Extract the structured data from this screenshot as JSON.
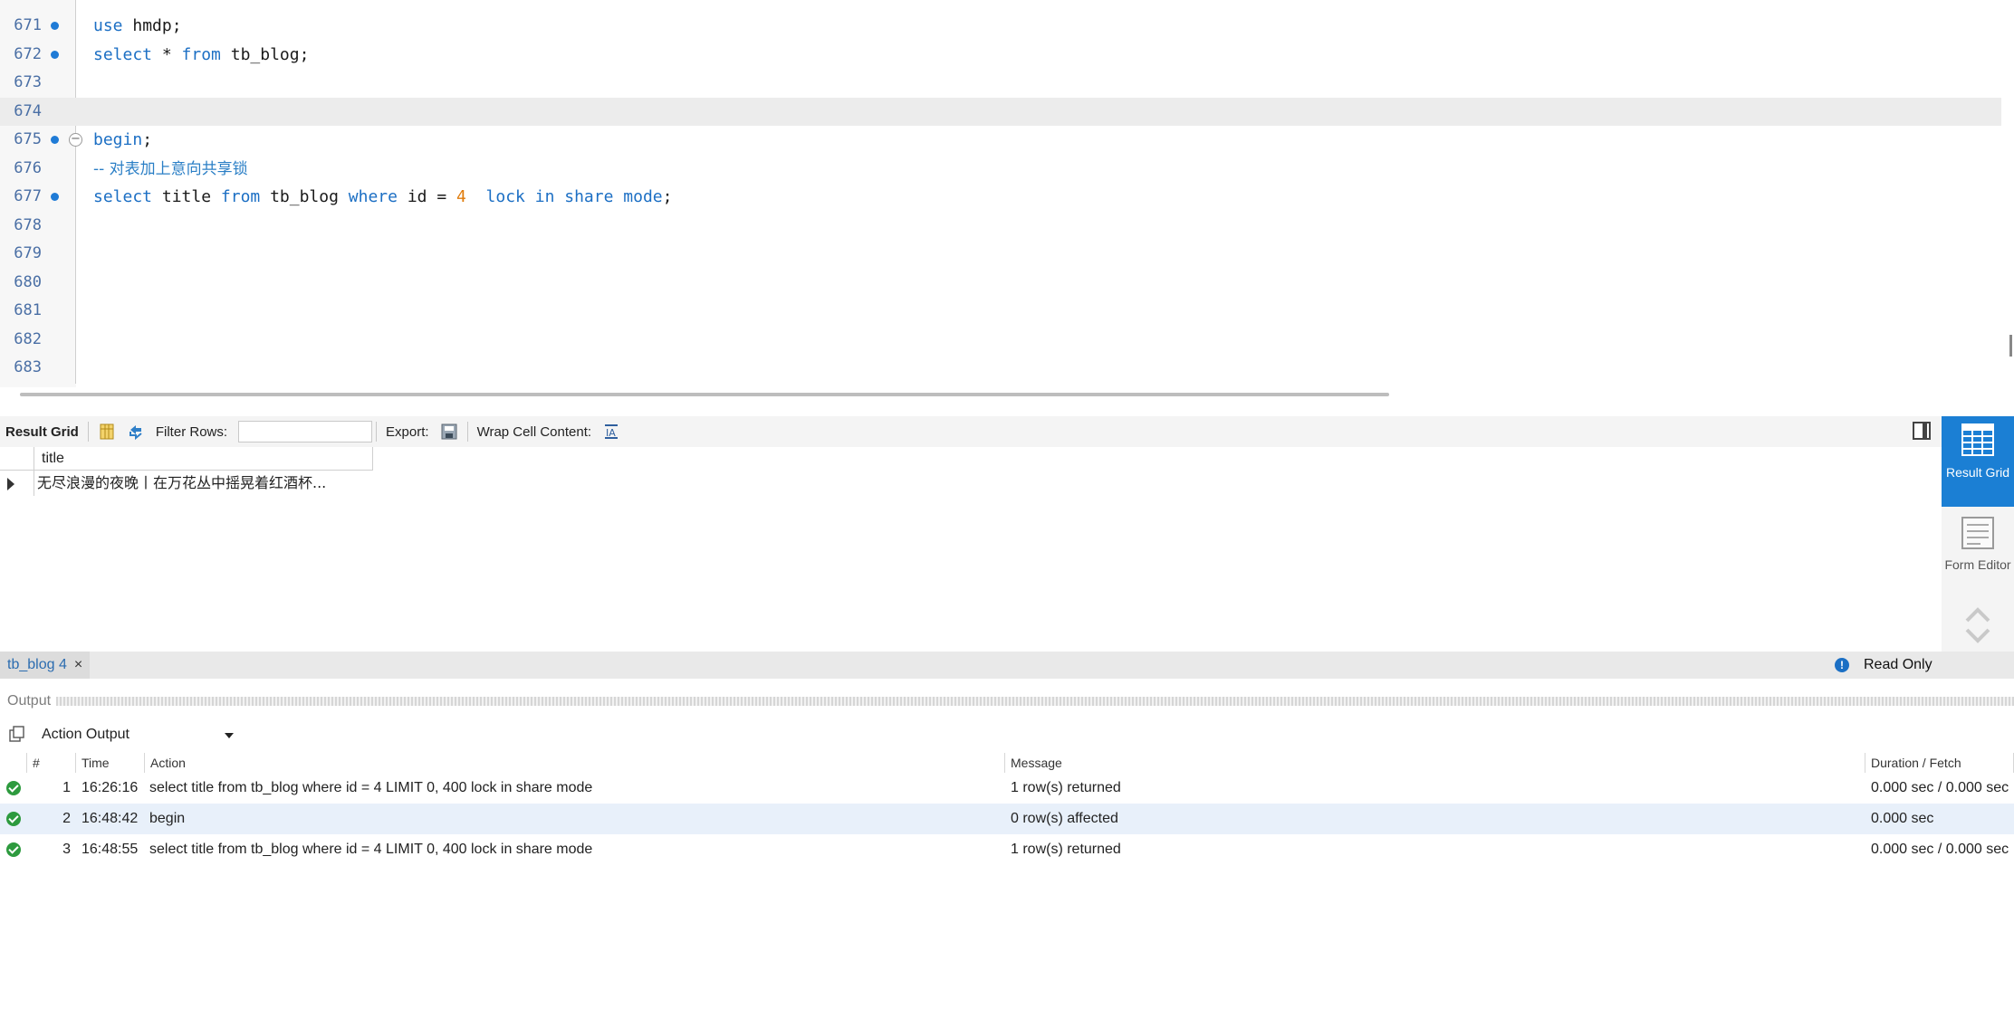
{
  "editor": {
    "lines": [
      {
        "num": "671",
        "tokens": [
          {
            "t": "use",
            "c": "kw"
          },
          {
            "t": " hmdp;",
            "c": ""
          }
        ],
        "marker": true,
        "fold": false,
        "current": false
      },
      {
        "num": "672",
        "tokens": [
          {
            "t": "select",
            "c": "kw"
          },
          {
            "t": " * ",
            "c": ""
          },
          {
            "t": "from",
            "c": "kw"
          },
          {
            "t": " tb_blog;",
            "c": ""
          }
        ],
        "marker": true,
        "fold": false,
        "current": false
      },
      {
        "num": "673",
        "tokens": [],
        "marker": false,
        "fold": false,
        "current": false
      },
      {
        "num": "674",
        "tokens": [],
        "marker": false,
        "fold": false,
        "current": true
      },
      {
        "num": "675",
        "tokens": [
          {
            "t": "begin",
            "c": "kw"
          },
          {
            "t": ";",
            "c": ""
          }
        ],
        "marker": true,
        "fold": true,
        "current": false
      },
      {
        "num": "676",
        "tokens": [
          {
            "t": "-- 对表加上意向共享锁",
            "c": "cmt"
          }
        ],
        "marker": false,
        "fold": false,
        "current": false
      },
      {
        "num": "677",
        "tokens": [
          {
            "t": "select",
            "c": "kw"
          },
          {
            "t": " title ",
            "c": ""
          },
          {
            "t": "from",
            "c": "kw"
          },
          {
            "t": " tb_blog ",
            "c": ""
          },
          {
            "t": "where",
            "c": "kw"
          },
          {
            "t": " id = ",
            "c": ""
          },
          {
            "t": "4",
            "c": "num"
          },
          {
            "t": "  ",
            "c": ""
          },
          {
            "t": "lock in share mode",
            "c": "kw"
          },
          {
            "t": ";",
            "c": ""
          }
        ],
        "marker": true,
        "fold": false,
        "current": false
      },
      {
        "num": "678",
        "tokens": [],
        "marker": false,
        "fold": false,
        "current": false
      },
      {
        "num": "679",
        "tokens": [],
        "marker": false,
        "fold": false,
        "current": false
      },
      {
        "num": "680",
        "tokens": [],
        "marker": false,
        "fold": false,
        "current": false
      },
      {
        "num": "681",
        "tokens": [],
        "marker": false,
        "fold": false,
        "current": false
      },
      {
        "num": "682",
        "tokens": [],
        "marker": false,
        "fold": false,
        "current": false
      },
      {
        "num": "683",
        "tokens": [],
        "marker": false,
        "fold": false,
        "current": false
      }
    ]
  },
  "result_toolbar": {
    "result_grid_label": "Result Grid",
    "filter_rows_label": "Filter Rows:",
    "filter_value": "",
    "export_label": "Export:",
    "wrap_label": "Wrap Cell Content:"
  },
  "result_grid": {
    "columns": [
      "title"
    ],
    "rows": [
      [
        "无尽浪漫的夜晚丨在万花丛中摇晃着红酒杯..."
      ]
    ]
  },
  "side_panel": {
    "result_grid": "Result Grid",
    "form_editor": "Form Editor"
  },
  "result_tab": {
    "label": "tb_blog 4",
    "close": "×",
    "read_only": "Read Only"
  },
  "output": {
    "title": "Output",
    "selector": "Action Output",
    "columns": {
      "num": "#",
      "time": "Time",
      "action": "Action",
      "message": "Message",
      "duration": "Duration / Fetch"
    },
    "rows": [
      {
        "num": "1",
        "time": "16:26:16",
        "action": "select title from tb_blog where id = 4   LIMIT 0, 400 lock in share mode",
        "message": "1 row(s) returned",
        "duration": "0.000 sec / 0.000 sec",
        "status": "success"
      },
      {
        "num": "2",
        "time": "16:48:42",
        "action": "begin",
        "message": "0 row(s) affected",
        "duration": "0.000 sec",
        "status": "success"
      },
      {
        "num": "3",
        "time": "16:48:55",
        "action": "select title from tb_blog where id = 4   LIMIT 0, 400 lock in share mode",
        "message": "1 row(s) returned",
        "duration": "0.000 sec / 0.000 sec",
        "status": "success"
      }
    ]
  },
  "colors": {
    "keyword": "#1c6fc4",
    "number": "#e07b0b",
    "line_number": "#4a6fa5",
    "accent": "#1b7fd4",
    "success": "#2d9a3e"
  }
}
